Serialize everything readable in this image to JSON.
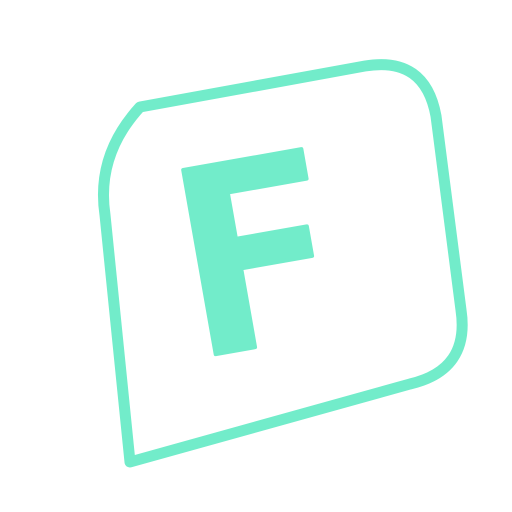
{
  "logo": {
    "letter": "F",
    "accent_color": "#72ecca",
    "background_color": "#ffffff",
    "icon": "tilted-rounded-square-f-logo"
  }
}
